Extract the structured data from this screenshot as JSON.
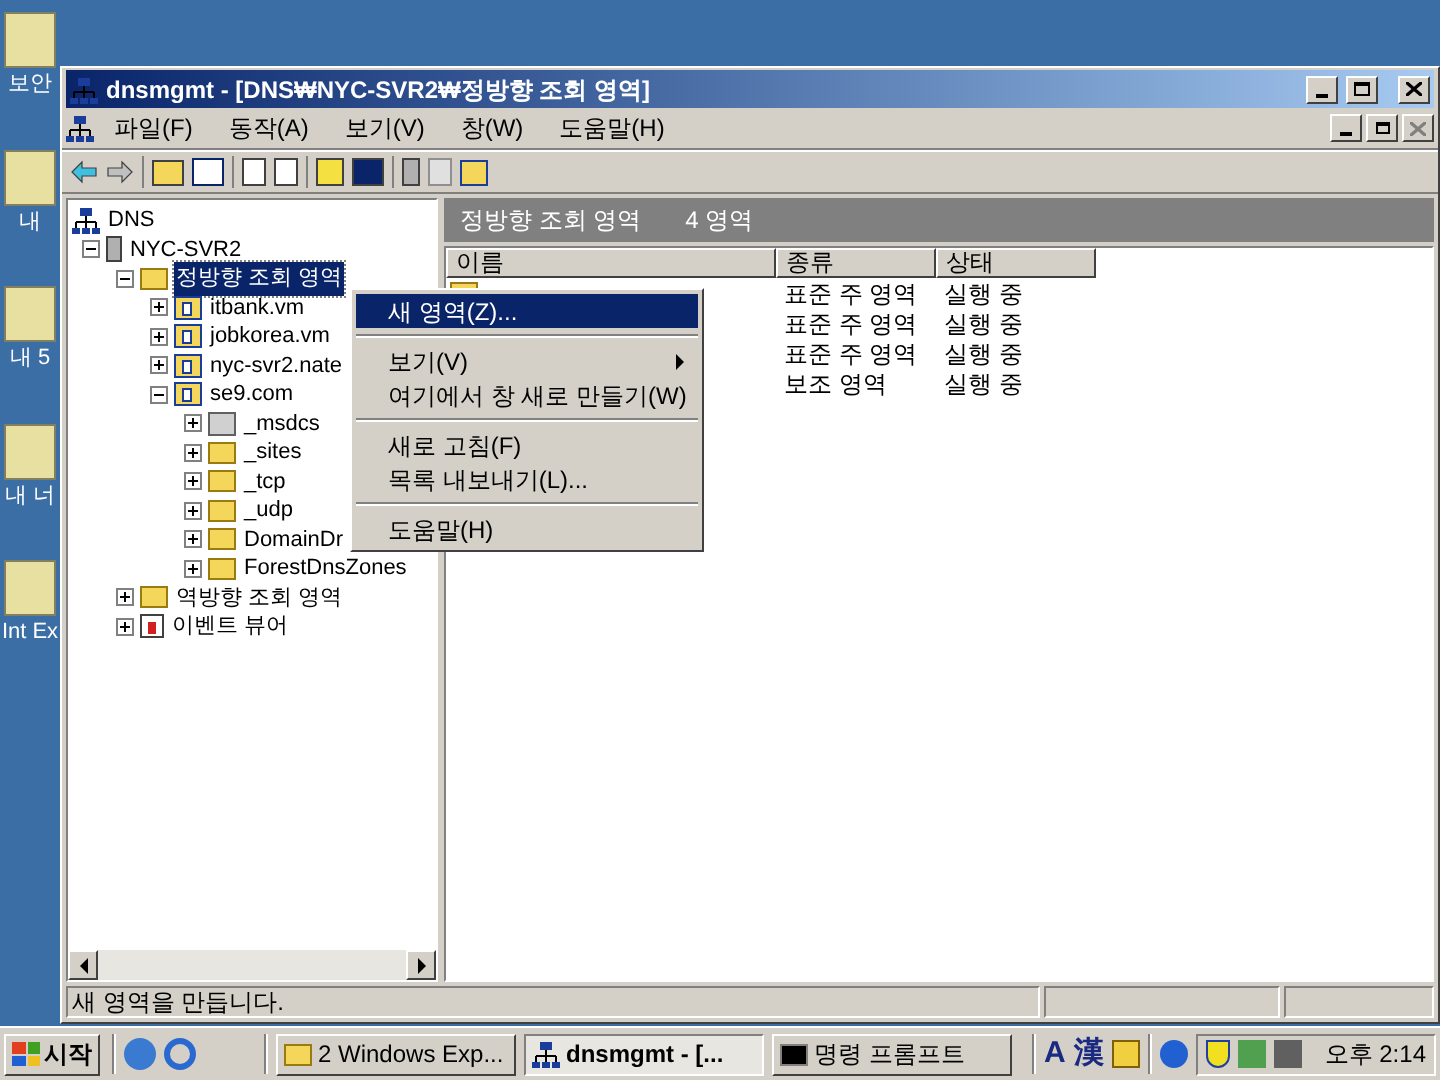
{
  "desktop_icons": [
    {
      "label": "보안"
    },
    {
      "label": "내"
    },
    {
      "label": "내 5"
    },
    {
      "label": "내 너"
    },
    {
      "label": "Int Ex"
    }
  ],
  "window": {
    "title": "dnsmgmt - [DNS₩NYC-SVR2₩정방향 조회 영역]"
  },
  "menu": [
    {
      "label": "파일(F)"
    },
    {
      "label": "동작(A)"
    },
    {
      "label": "보기(V)"
    },
    {
      "label": "창(W)"
    },
    {
      "label": "도움말(H)"
    }
  ],
  "tree": [
    {
      "label": "DNS",
      "kind": "dns",
      "selected": false,
      "children": [
        {
          "label": "NYC-SVR2",
          "kind": "server",
          "selected": false,
          "expanded": true,
          "children": [
            {
              "label": "정방향 조회 영역",
              "kind": "folder",
              "selected": true,
              "expanded": true,
              "children": [
                {
                  "label": "itbank.vm",
                  "kind": "zone",
                  "selected": false,
                  "expanded": false
                },
                {
                  "label": "jobkorea.vm",
                  "kind": "zone",
                  "selected": false,
                  "expanded": false
                },
                {
                  "label": "nyc-svr2.nate",
                  "kind": "zone",
                  "selected": false,
                  "expanded": false
                },
                {
                  "label": "se9.com",
                  "kind": "zone",
                  "selected": false,
                  "expanded": true,
                  "children": [
                    {
                      "label": "_msdcs",
                      "kind": "delegation",
                      "selected": false,
                      "expanded": false
                    },
                    {
                      "label": "_sites",
                      "kind": "folder",
                      "selected": false,
                      "expanded": false
                    },
                    {
                      "label": "_tcp",
                      "kind": "folder",
                      "selected": false,
                      "expanded": false
                    },
                    {
                      "label": "_udp",
                      "kind": "folder",
                      "selected": false,
                      "expanded": false
                    },
                    {
                      "label": "DomainDr",
                      "kind": "folder",
                      "selected": false,
                      "expanded": false
                    },
                    {
                      "label": "ForestDnsZones",
                      "kind": "folder",
                      "selected": false,
                      "expanded": false
                    }
                  ]
                }
              ]
            },
            {
              "label": "역방향 조회 영역",
              "kind": "folder",
              "selected": false,
              "expanded": false
            },
            {
              "label": "이벤트 뷰어",
              "kind": "event",
              "selected": false,
              "expanded": false
            }
          ]
        }
      ]
    }
  ],
  "pane": {
    "title": "정방향 조회 영역",
    "count": "4 영역",
    "columns": [
      "이름",
      "종류",
      "상태"
    ],
    "rows": [
      {
        "type": "표준 주 영역",
        "status": "실행 중"
      },
      {
        "type": "표준 주 영역",
        "status": "실행 중"
      },
      {
        "type": "표준 주 영역",
        "status": "실행 중"
      },
      {
        "type": "보조 영역",
        "status": "실행 중"
      }
    ]
  },
  "context_menu": [
    {
      "kind": "item",
      "label": "새 영역(Z)...",
      "selected": true
    },
    {
      "kind": "separator"
    },
    {
      "kind": "submenu",
      "label": "보기(V)",
      "selected": false
    },
    {
      "kind": "item",
      "label": "여기에서 창 새로 만들기(W)",
      "selected": false
    },
    {
      "kind": "separator"
    },
    {
      "kind": "item",
      "label": "새로 고침(F)",
      "selected": false
    },
    {
      "kind": "item",
      "label": "목록 내보내기(L)...",
      "selected": false
    },
    {
      "kind": "separator"
    },
    {
      "kind": "item",
      "label": "도움말(H)",
      "selected": false
    }
  ],
  "status_bar": "새 영역을 만듭니다.",
  "taskbar": {
    "start": "시작",
    "tasks": [
      {
        "label": "2 Windows Exp...",
        "kind": "group",
        "selected": false
      },
      {
        "label": "dnsmgmt - [...",
        "kind": "dns",
        "selected": true
      },
      {
        "label": "명령 프롬프트",
        "kind": "cmd",
        "selected": false
      }
    ],
    "language_bar": [
      "A",
      "漢"
    ],
    "clock": "오후 2:14"
  }
}
